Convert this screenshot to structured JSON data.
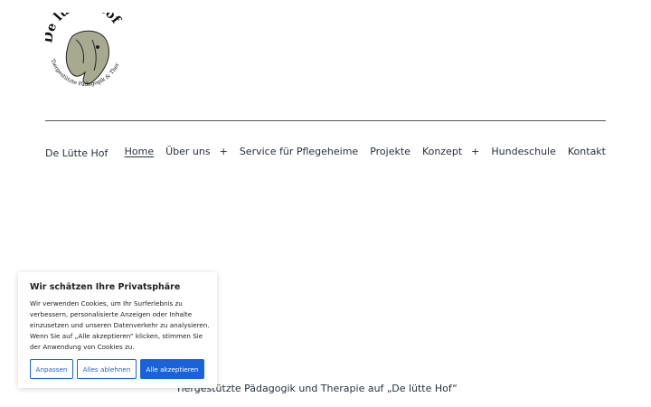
{
  "logo": {
    "name_text": "De lütte Hof",
    "subtitle_text": "Tiergestützte Pädagogik & Therapie"
  },
  "header": {
    "site_title": "De Lütte Hof"
  },
  "nav": {
    "items": [
      {
        "label": "Home",
        "active": true
      },
      {
        "label": "Über uns"
      },
      {
        "label": "Service für Pflegeheime"
      },
      {
        "label": "Projekte"
      },
      {
        "label": "Konzept"
      },
      {
        "label": "Hundeschule"
      },
      {
        "label": "Kontakt"
      }
    ],
    "submenu_icon": "+"
  },
  "main": {
    "tagline": "Tiergestützte Pädagogik und Therapie auf „De lütte Hof“"
  },
  "cookie_banner": {
    "title": "Wir schätzen Ihre Privatsphäre",
    "text": "Wir verwenden Cookies, um Ihr Surferlebnis zu verbessern, personalisierte Anzeigen oder Inhalte einzusetzen und unseren Datenverkehr zu analysieren. Wenn Sie auf „Alle akzeptieren“ klicken, stimmen Sie der Anwendung von Cookies zu.",
    "customize_label": "Anpassen",
    "reject_label": "Alles ablehnen",
    "accept_label": "Alle akzeptieren"
  },
  "colors": {
    "accent": "#1863dc",
    "text": "#28303d",
    "logo_horse": "#a8aa90"
  }
}
